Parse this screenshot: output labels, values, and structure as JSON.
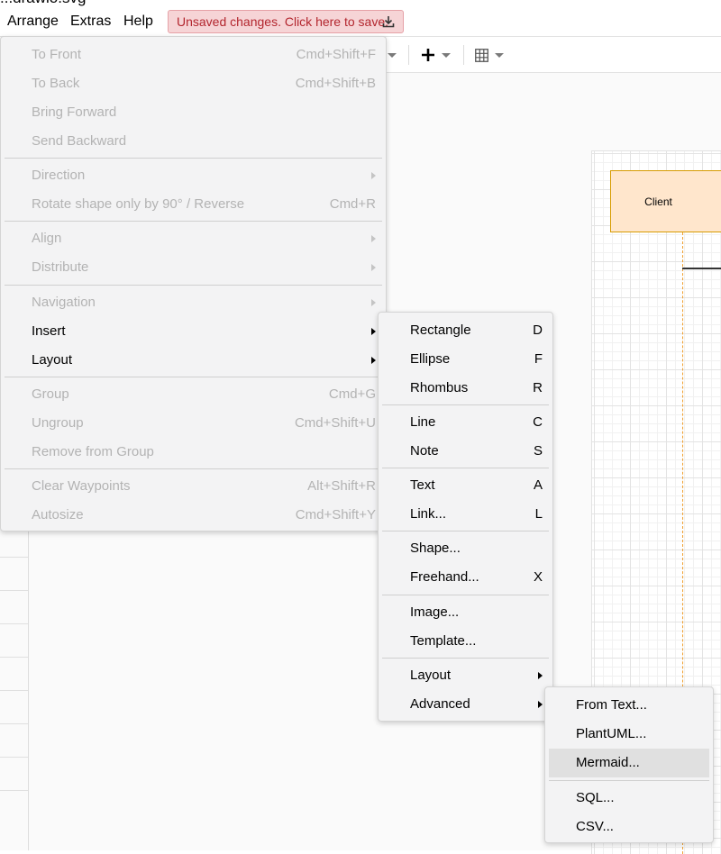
{
  "window": {
    "title_fragment": "...drawio.svg"
  },
  "menubar": {
    "items": [
      "Arrange",
      "Extras",
      "Help"
    ],
    "unsaved_text": "Unsaved changes. Click here to save."
  },
  "toolbar": {
    "icons": [
      "caret-down-icon",
      "plus-icon",
      "table-icon"
    ]
  },
  "diagram": {
    "client_label": "Client"
  },
  "arrange_menu": {
    "items": [
      {
        "label": "To Front",
        "shortcut": "Cmd+Shift+F",
        "disabled": true
      },
      {
        "label": "To Back",
        "shortcut": "Cmd+Shift+B",
        "disabled": true
      },
      {
        "label": "Bring Forward",
        "shortcut": "",
        "disabled": true
      },
      {
        "label": "Send Backward",
        "shortcut": "",
        "disabled": true
      },
      {
        "label": "Direction",
        "shortcut": "",
        "disabled": true,
        "submenu": true
      },
      {
        "label": "Rotate shape only by 90° / Reverse",
        "shortcut": "Cmd+R",
        "disabled": true
      },
      {
        "label": "Align",
        "shortcut": "",
        "disabled": true,
        "submenu": true
      },
      {
        "label": "Distribute",
        "shortcut": "",
        "disabled": true,
        "submenu": true
      },
      {
        "label": "Navigation",
        "shortcut": "",
        "disabled": true,
        "submenu": true
      },
      {
        "label": "Insert",
        "shortcut": "",
        "disabled": false,
        "submenu": true
      },
      {
        "label": "Layout",
        "shortcut": "",
        "disabled": false,
        "submenu": true
      },
      {
        "label": "Group",
        "shortcut": "Cmd+G",
        "disabled": true
      },
      {
        "label": "Ungroup",
        "shortcut": "Cmd+Shift+U",
        "disabled": true
      },
      {
        "label": "Remove from Group",
        "shortcut": "",
        "disabled": true
      },
      {
        "label": "Clear Waypoints",
        "shortcut": "Alt+Shift+R",
        "disabled": true
      },
      {
        "label": "Autosize",
        "shortcut": "Cmd+Shift+Y",
        "disabled": true
      }
    ]
  },
  "insert_menu": {
    "items": [
      {
        "label": "Rectangle",
        "shortcut": "D"
      },
      {
        "label": "Ellipse",
        "shortcut": "F"
      },
      {
        "label": "Rhombus",
        "shortcut": "R"
      },
      {
        "label": "Line",
        "shortcut": "C"
      },
      {
        "label": "Note",
        "shortcut": "S"
      },
      {
        "label": "Text",
        "shortcut": "A"
      },
      {
        "label": "Link...",
        "shortcut": "L"
      },
      {
        "label": "Shape...",
        "shortcut": ""
      },
      {
        "label": "Freehand...",
        "shortcut": "X"
      },
      {
        "label": "Image...",
        "shortcut": ""
      },
      {
        "label": "Template...",
        "shortcut": ""
      },
      {
        "label": "Layout",
        "shortcut": "",
        "submenu": true
      },
      {
        "label": "Advanced",
        "shortcut": "",
        "submenu": true
      }
    ]
  },
  "advanced_menu": {
    "items": [
      {
        "label": "From Text..."
      },
      {
        "label": "PlantUML..."
      },
      {
        "label": "Mermaid...",
        "highlighted": true
      },
      {
        "label": "SQL..."
      },
      {
        "label": "CSV..."
      }
    ]
  },
  "colors": {
    "menu_bg": "#f3f3f4",
    "disabled_text": "#b3b3b3",
    "unsaved_bg": "#f6d4d6",
    "unsaved_text": "#b3262e",
    "client_fill": "#ffe6cc",
    "client_stroke": "#d79b00"
  }
}
